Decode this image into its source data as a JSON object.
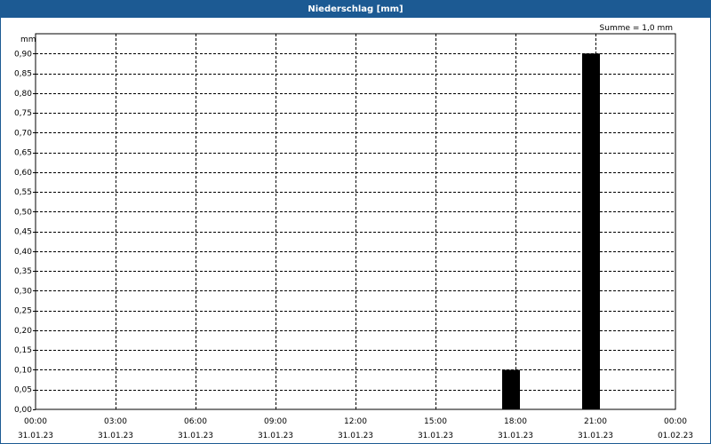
{
  "window": {
    "title": "Niederschlag [mm]"
  },
  "chart_data": {
    "type": "bar",
    "ylabel": "mm",
    "annotation": "Summe = 1,0 mm",
    "ylim": [
      0,
      0.95
    ],
    "y_ticks": [
      0,
      0.05,
      0.1,
      0.15,
      0.2,
      0.25,
      0.3,
      0.35,
      0.4,
      0.45,
      0.5,
      0.55,
      0.6,
      0.65,
      0.7,
      0.75,
      0.8,
      0.85,
      0.9
    ],
    "y_tick_labels": [
      "0,00",
      "0,05",
      "0,10",
      "0,15",
      "0,20",
      "0,25",
      "0,30",
      "0,35",
      "0,40",
      "0,45",
      "0,50",
      "0,55",
      "0,60",
      "0,65",
      "0,70",
      "0,75",
      "0,80",
      "0,85",
      "0,90"
    ],
    "xlim_hours": [
      0,
      24
    ],
    "x_ticks_hours": [
      0,
      3,
      6,
      9,
      12,
      15,
      18,
      21,
      24
    ],
    "x_tick_labels": [
      {
        "time": "00:00",
        "date": "31.01.23"
      },
      {
        "time": "03:00",
        "date": "31.01.23"
      },
      {
        "time": "06:00",
        "date": "31.01.23"
      },
      {
        "time": "09:00",
        "date": "31.01.23"
      },
      {
        "time": "12:00",
        "date": "31.01.23"
      },
      {
        "time": "15:00",
        "date": "31.01.23"
      },
      {
        "time": "18:00",
        "date": "31.01.23"
      },
      {
        "time": "21:00",
        "date": "31.01.23"
      },
      {
        "time": "00:00",
        "date": "01.02.23"
      }
    ],
    "bars": [
      {
        "start": "17:30",
        "end": "18:10",
        "value": 0.1
      },
      {
        "start": "20:30",
        "end": "21:10",
        "value": 0.9
      }
    ],
    "grid": true,
    "bar_color": "#000000",
    "grid_color": "#000000"
  }
}
